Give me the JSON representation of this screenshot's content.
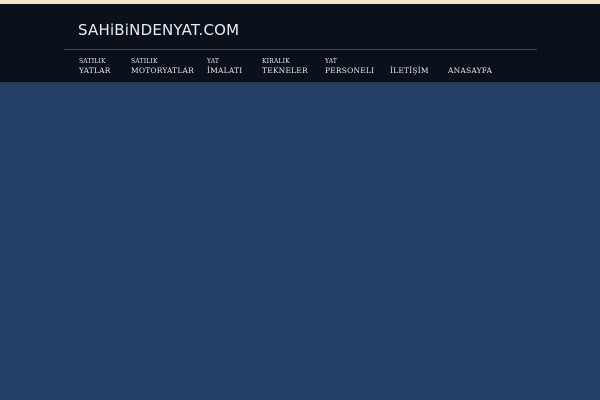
{
  "site": {
    "logo_text": "SAHiBiNDENYAT.COM"
  },
  "nav": {
    "items": [
      {
        "line1": "SATILIK",
        "line2": "YATLAR"
      },
      {
        "line1": "SATILIK",
        "line2": "MOTORYATLAR"
      },
      {
        "line1": "YAT",
        "line2": "İMALATI"
      },
      {
        "line1": "KIRALIK",
        "line2": "TEKNELER"
      },
      {
        "line1": "YAT",
        "line2": "PERSONELI"
      },
      {
        "label": "İLETİŞİM"
      },
      {
        "label": "ANASAYFA"
      }
    ]
  },
  "colors": {
    "header_bg": "#0b111b",
    "content_bg": "#243f66",
    "top_strip": "#f3e6cf",
    "text": "#e7e9ee"
  }
}
